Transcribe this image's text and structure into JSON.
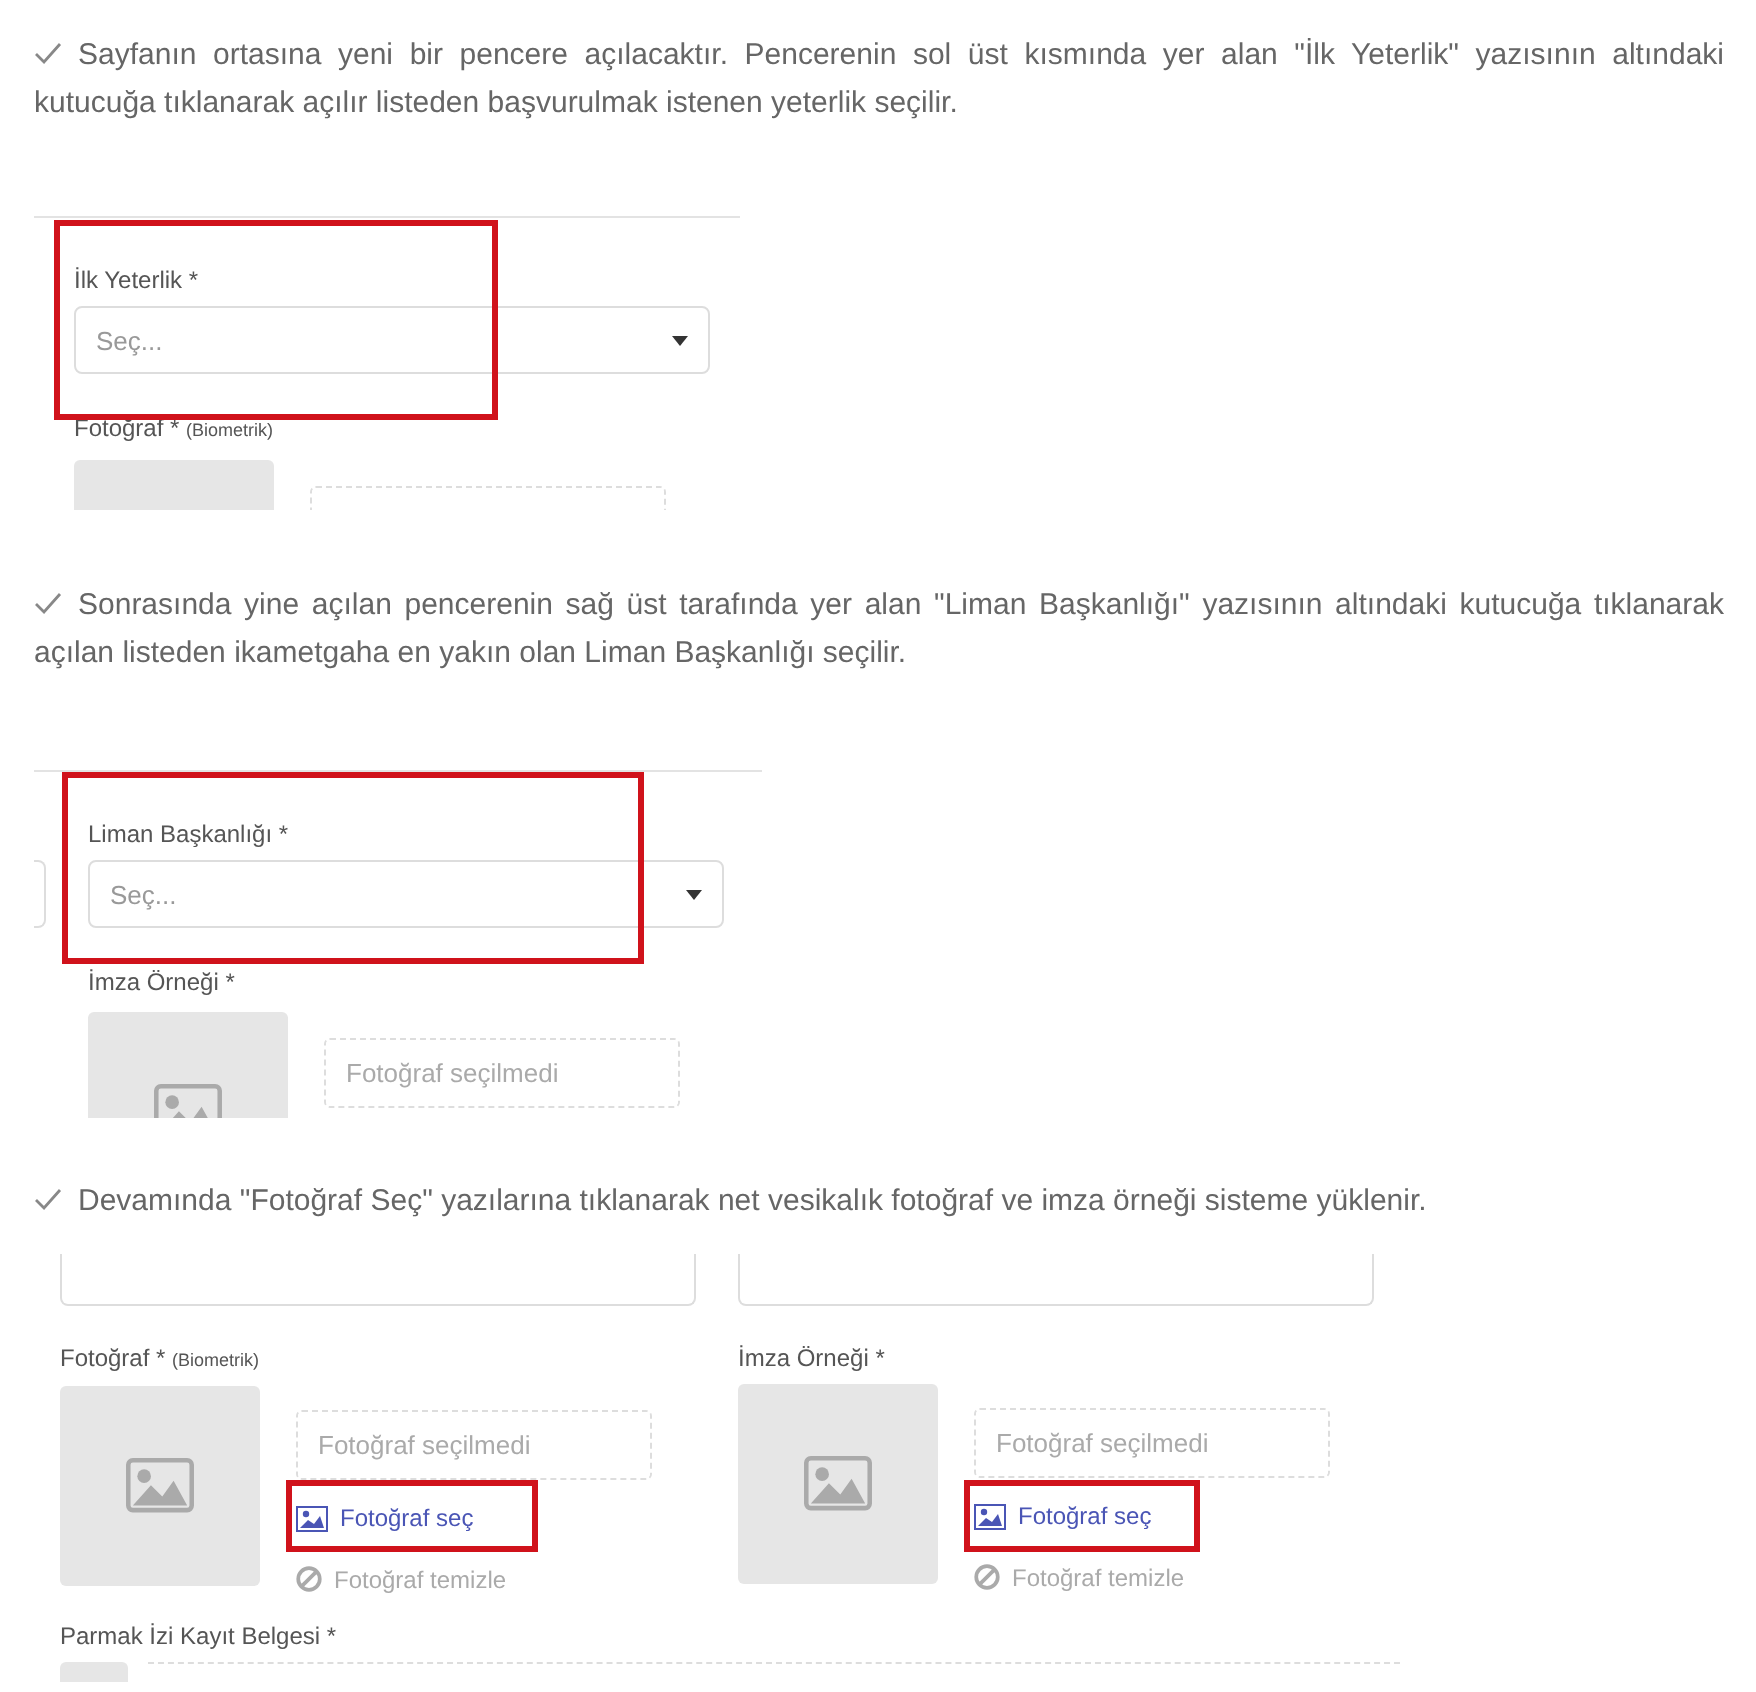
{
  "steps": [
    {
      "text": "Sayfanın ortasına yeni bir pencere açılacaktır. Pencerenin sol üst kısmında yer alan \"İlk Yeterlik\" yazısının altındaki kutucuğa tıklanarak açılır listeden başvurulmak istenen yeterlik seçilir.",
      "panel": {
        "kind": "select",
        "select_field": {
          "label": "İlk Yeterlik *",
          "placeholder": "Seç..."
        },
        "photo_label": {
          "text": "Fotoğraf *",
          "note": "(Biometrik)"
        }
      }
    },
    {
      "text": "Sonrasında yine açılan pencerenin sağ üst tarafında yer alan \"Liman Başkanlığı\" yazısının altındaki kutucuğa tıklanarak açılan listeden ikametgaha en yakın olan Liman Başkanlığı seçilir.",
      "panel": {
        "kind": "select",
        "select_field": {
          "label": "Liman Başkanlığı *",
          "placeholder": "Seç..."
        },
        "photo_label": {
          "text": "İmza Örneği *"
        },
        "photo_status": "Fotoğraf seçilmedi"
      }
    },
    {
      "text": "Devamında \"Fotoğraf Seç\" yazılarına tıklanarak net vesikalık fotoğraf ve imza örneği sisteme yüklenir.",
      "panel": {
        "kind": "upload",
        "uploads": [
          {
            "label": "Fotoğraf *",
            "note": "(Biometrik)",
            "status": "Fotoğraf seçilmedi",
            "choose": "Fotoğraf seç",
            "clear": "Fotoğraf temizle"
          },
          {
            "label": "İmza Örneği *",
            "status": "Fotoğraf seçilmedi",
            "choose": "Fotoğraf seç",
            "clear": "Fotoğraf temizle"
          }
        ],
        "next_label": "Parmak İzi Kayıt Belgesi *"
      }
    }
  ]
}
